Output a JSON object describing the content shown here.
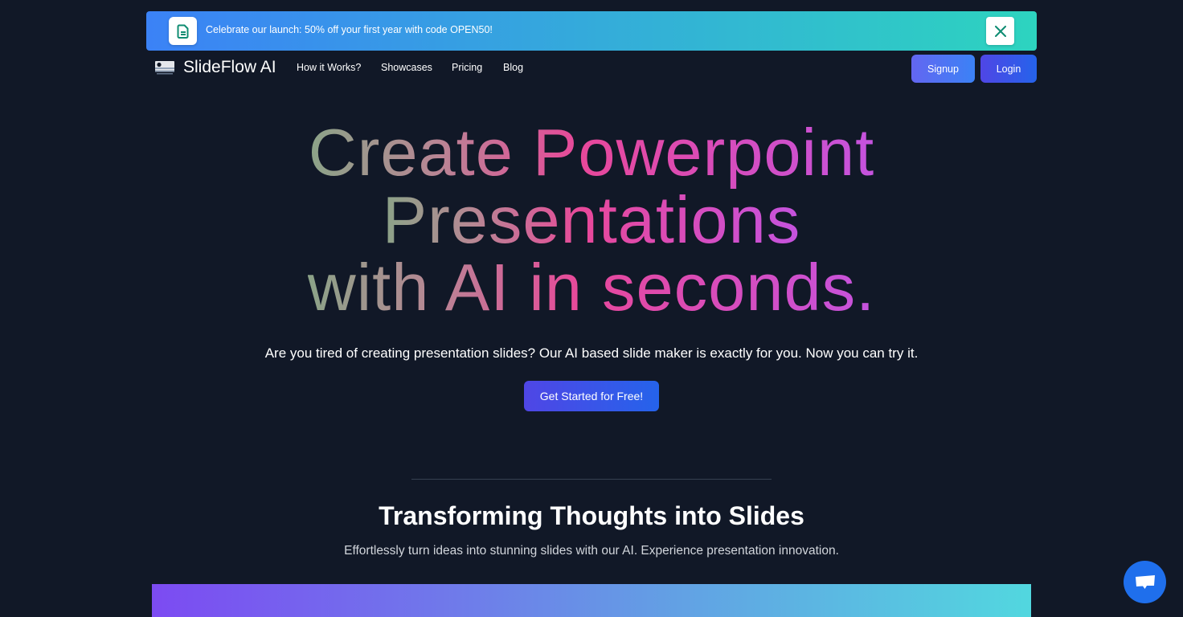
{
  "banner": {
    "icon": "document-icon",
    "text": "Celebrate our launch: 50% off your first year with code OPEN50!",
    "close_icon": "close-icon"
  },
  "nav": {
    "brand": "SlideFlow AI",
    "logo_icon": "slides-logo-icon",
    "links": [
      "How it Works?",
      "Showcases",
      "Pricing",
      "Blog"
    ],
    "signup_label": "Signup",
    "login_label": "Login"
  },
  "hero": {
    "title_lines": [
      "Create Powerpoint",
      "Presentations",
      "with AI in seconds."
    ],
    "subtitle": "Are you tired of creating presentation slides? Our AI based slide maker is exactly for you. Now you can try it.",
    "cta_label": "Get Started for Free!"
  },
  "section": {
    "title": "Transforming Thoughts into Slides",
    "subtitle": "Effortlessly turn ideas into stunning slides with our AI. Experience presentation innovation."
  },
  "chat": {
    "icon": "chat-icon"
  },
  "colors": {
    "background": "#111827",
    "banner_start": "#3b82f6",
    "banner_end": "#2dd4bf",
    "accent": "#4f46e5",
    "chat": "#1f6fec"
  }
}
